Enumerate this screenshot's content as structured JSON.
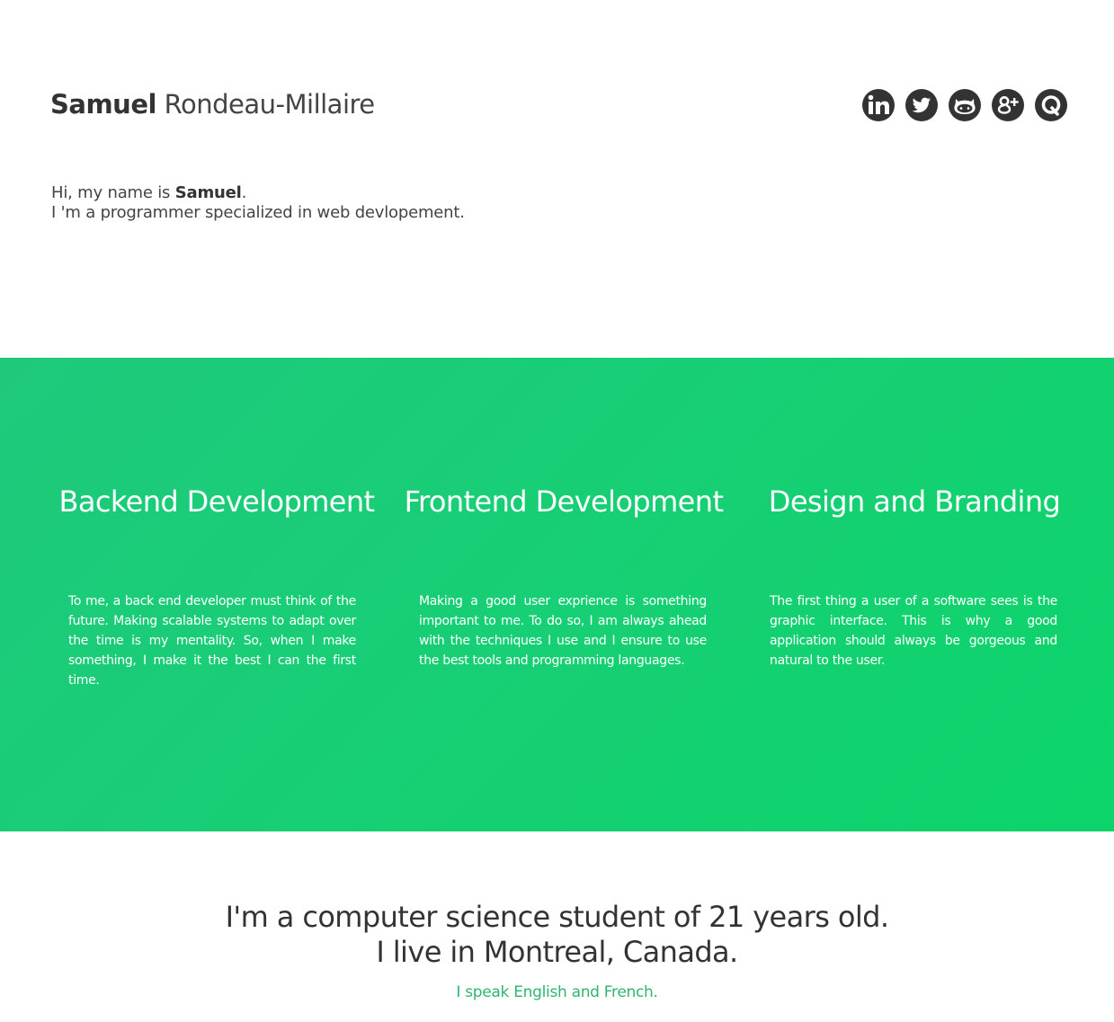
{
  "header": {
    "first_name": "Samuel",
    "last_name": " Rondeau-Millaire",
    "social": [
      {
        "name": "linkedin-icon"
      },
      {
        "name": "twitter-icon"
      },
      {
        "name": "github-icon"
      },
      {
        "name": "google-plus-icon"
      },
      {
        "name": "quora-icon"
      }
    ],
    "icon_color": "#333333"
  },
  "intro": {
    "greeting_prefix": "Hi, my name is ",
    "greeting_name": "Samuel",
    "greeting_suffix": ".",
    "line2": "I 'm a programmer specialized in web devlopement."
  },
  "services": {
    "background_colors": [
      "#1ec97c",
      "#0bd46a"
    ],
    "items": [
      {
        "title": "Backend Development",
        "text": "To me, a back end developer must think of the future. Making scalable systems to adapt over the time is my mentality. So, when I make something, I make it the best I can the first time."
      },
      {
        "title": "Frontend Development",
        "text": "Making a good user exprience is something important to me. To do so, I am always ahead with the techniques I use and I ensure to use the best tools and programming languages."
      },
      {
        "title": "Design and Branding",
        "text": "The first thing a user of a software sees is the graphic interface. This is why a good application should always be gorgeous and natural to the user."
      }
    ]
  },
  "about": {
    "line1": "I'm a computer science student of 21 years old.",
    "line2": "I live in Montreal, Canada.",
    "languages": "I speak English and French.",
    "accent_color": "#2fb56f"
  }
}
